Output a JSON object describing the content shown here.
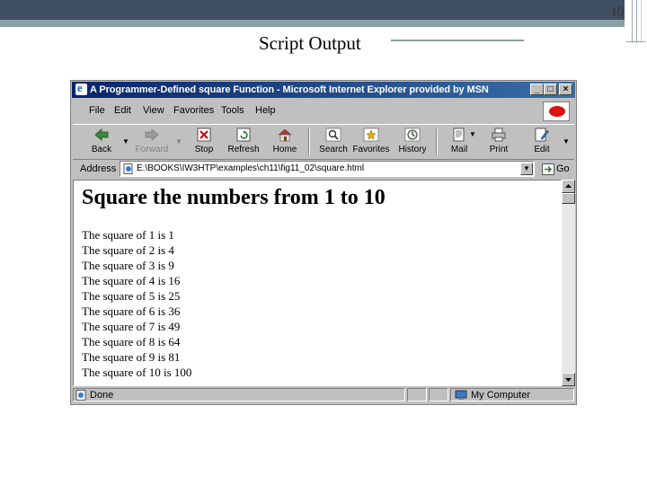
{
  "slide": {
    "page_number": "10",
    "title": "Script Output"
  },
  "window": {
    "title": "A Programmer-Defined square Function - Microsoft Internet Explorer provided by MSN",
    "controls": [
      "_",
      "□",
      "×"
    ]
  },
  "menu": [
    {
      "label": "File"
    },
    {
      "label": "Edit"
    },
    {
      "label": "View"
    },
    {
      "label": "Favorites"
    },
    {
      "label": "Tools"
    },
    {
      "label": "Help"
    }
  ],
  "toolbar": [
    {
      "label": "Back",
      "icon": "back-arrow-icon",
      "enabled": true
    },
    {
      "label": "Forward",
      "icon": "forward-arrow-icon",
      "enabled": false
    },
    {
      "label": "Stop",
      "icon": "stop-icon",
      "enabled": true
    },
    {
      "label": "Refresh",
      "icon": "refresh-icon",
      "enabled": true
    },
    {
      "label": "Home",
      "icon": "home-icon",
      "enabled": true
    },
    {
      "label": "Search",
      "icon": "search-icon",
      "enabled": true
    },
    {
      "label": "Favorites",
      "icon": "favorites-icon",
      "enabled": true
    },
    {
      "label": "History",
      "icon": "history-icon",
      "enabled": true
    },
    {
      "label": "Mail",
      "icon": "mail-icon",
      "enabled": true
    },
    {
      "label": "Print",
      "icon": "print-icon",
      "enabled": true
    },
    {
      "label": "Edit",
      "icon": "edit-icon",
      "enabled": true
    }
  ],
  "address": {
    "label": "Address",
    "value": "E:\\BOOKS\\IW3HTP\\examples\\ch11\\fig11_02\\square.html",
    "go_label": "Go"
  },
  "content": {
    "heading": "Square the numbers from 1 to 10",
    "lines": [
      "The square of 1 is 1",
      "The square of 2 is 4",
      "The square of 3 is 9",
      "The square of 4 is 16",
      "The square of 5 is 25",
      "The square of 6 is 36",
      "The square of 7 is 49",
      "The square of 8 is 64",
      "The square of 9 is 81",
      "The square of 10 is 100"
    ]
  },
  "status": {
    "text": "Done",
    "zone": "My Computer"
  },
  "colors": {
    "titlebar_start": "#0a246a",
    "titlebar_end": "#3a6ea5",
    "chrome": "#c0c0c0",
    "slide_bar": "#3f4e60",
    "slide_accent": "#8aa0a4"
  }
}
